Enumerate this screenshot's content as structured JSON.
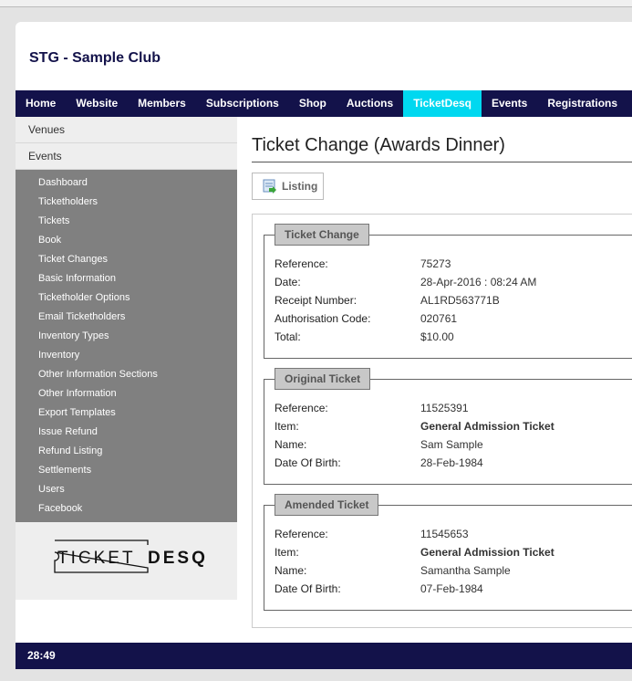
{
  "header": {
    "title": "STG - Sample Club"
  },
  "nav": [
    "Home",
    "Website",
    "Members",
    "Subscriptions",
    "Shop",
    "Auctions",
    "TicketDesq",
    "Events",
    "Registrations"
  ],
  "nav_active": "TicketDesq",
  "sidebar": {
    "sections": [
      "Venues",
      "Events"
    ],
    "items": [
      "Dashboard",
      "Ticketholders",
      "Tickets",
      "Book",
      "Ticket Changes",
      "Basic Information",
      "Ticketholder Options",
      "Email Ticketholders",
      "Inventory Types",
      "Inventory",
      "Other Information Sections",
      "Other Information",
      "Export Templates",
      "Issue Refund",
      "Refund Listing",
      "Settlements",
      "Users",
      "Facebook"
    ],
    "logo": "TICKETDESQ"
  },
  "main": {
    "title": "Ticket Change (Awards Dinner)",
    "listing_button": "Listing",
    "fieldsets": [
      {
        "legend": "Ticket Change",
        "rows": [
          {
            "label": "Reference:",
            "value": "75273"
          },
          {
            "label": "Date:",
            "value": "28-Apr-2016 : 08:24 AM"
          },
          {
            "label": "Receipt Number:",
            "value": "AL1RD563771B"
          },
          {
            "label": "Authorisation Code:",
            "value": "020761"
          },
          {
            "label": "Total:",
            "value": "$10.00"
          }
        ]
      },
      {
        "legend": "Original Ticket",
        "rows": [
          {
            "label": "Reference:",
            "value": "11525391"
          },
          {
            "label": "Item:",
            "value": "General Admission Ticket",
            "bold": true
          },
          {
            "label": "Name:",
            "value": "Sam Sample"
          },
          {
            "label": "Date Of Birth:",
            "value": "28-Feb-1984"
          }
        ]
      },
      {
        "legend": "Amended Ticket",
        "rows": [
          {
            "label": "Reference:",
            "value": "11545653"
          },
          {
            "label": "Item:",
            "value": "General Admission Ticket",
            "bold": true
          },
          {
            "label": "Name:",
            "value": "Samantha Sample"
          },
          {
            "label": "Date Of Birth:",
            "value": "07-Feb-1984"
          }
        ]
      }
    ]
  },
  "footer": {
    "timer": "28:49"
  },
  "colors": {
    "nav": "#13124a",
    "active": "#00d8f0",
    "sidebar_sub": "#808080"
  }
}
